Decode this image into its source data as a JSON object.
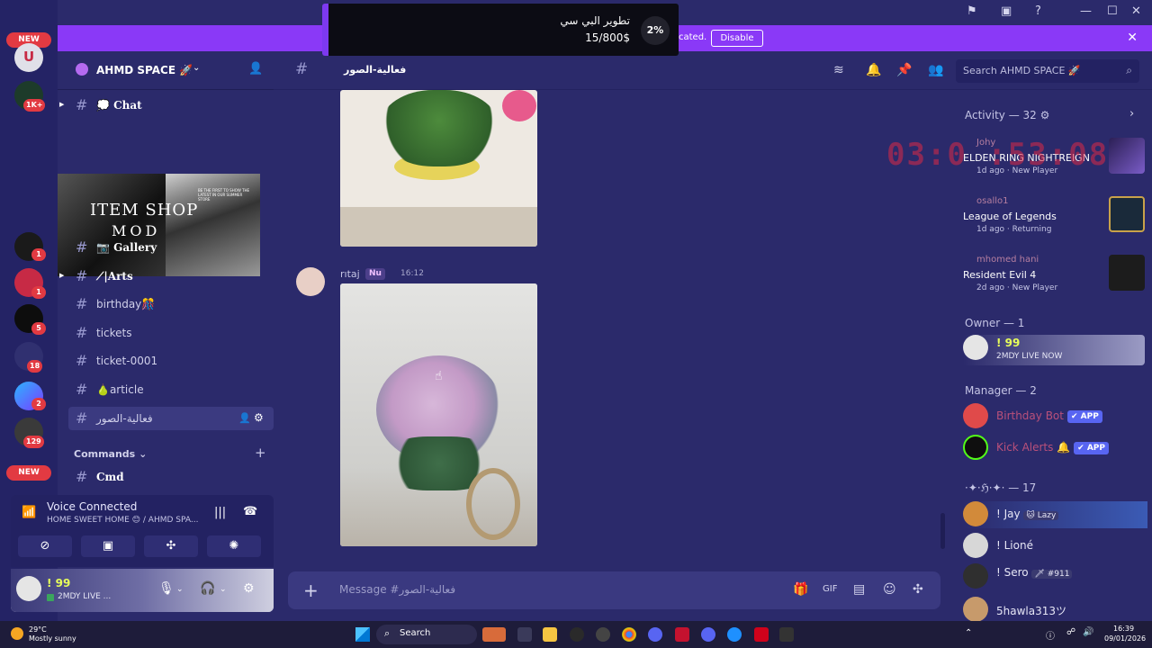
{
  "rail": {
    "new_label": "NEW",
    "badges": [
      "1K+",
      "1",
      "1",
      "5",
      "18",
      "2",
      "129"
    ]
  },
  "notice": {
    "text": "cated.",
    "button": "Disable"
  },
  "donation": {
    "title": "تطوير البي سي",
    "amount": "15/800$",
    "percent": "2%",
    "progress": 0.02
  },
  "server": {
    "name": "AHMD SPACE 🚀"
  },
  "channels": [
    {
      "label": "💭 Chat",
      "bold": true
    },
    {
      "label": "📷 Gallery",
      "bold": true
    },
    {
      "label": "⟋|Arts",
      "bold": true
    },
    {
      "label": "birthday🎊",
      "bold": false
    },
    {
      "label": "tickets",
      "bold": false
    },
    {
      "label": "ticket-0001",
      "bold": false
    },
    {
      "label": "🍐article",
      "bold": false
    },
    {
      "label": "فعالية-الصور",
      "bold": false,
      "active": true
    }
  ],
  "category": {
    "label": "Commands",
    "channel": "Cmd"
  },
  "itemshop": {
    "line1": "ITEM SHOP",
    "line2": "MOD",
    "small": "BE THE FIRST TO SHOW THE LATEST IN OUR SUMMER STORE"
  },
  "voice": {
    "title": "Voice Connected",
    "subtitle": "HOME SWEET HOME 😊 / AHMD SPA..."
  },
  "user": {
    "name": "! 99",
    "status": "2MDY LIVE ..."
  },
  "chat": {
    "channel": "فعالية-الصور",
    "search_placeholder": "Search AHMD SPACE 🚀",
    "author": "rıtaj",
    "author_tag": "Nu",
    "time": "16:12",
    "composer_placeholder": "Message #فعالية-الصور"
  },
  "members": {
    "activity_header": "Activity — 32",
    "timer": "03:0 :53:08",
    "activities": [
      {
        "user": "Johy",
        "game": "ELDEN RING NIGHTREIGN",
        "when": "1d ago",
        "status": "New Player"
      },
      {
        "user": "osallo1",
        "game": "League of Legends",
        "when": "1d ago",
        "status": "Returning"
      },
      {
        "user": "mhomed hani",
        "game": "Resident Evil 4",
        "when": "2d ago",
        "status": "New Player"
      }
    ],
    "owner_header": "Owner — 1",
    "owner": {
      "name": "! 99",
      "status": "2MDY LIVE NOW"
    },
    "manager_header": "Manager — 2",
    "managers": [
      {
        "name": "Birthday Bot",
        "badge": "✔ APP"
      },
      {
        "name": "Kick Alerts 🔔",
        "badge": "✔ APP"
      }
    ],
    "group_header": "·✦·ℌ·✦· — 17",
    "group": [
      {
        "name": "! Jay",
        "tag": "🐱 Lazy"
      },
      {
        "name": "! Lioné",
        "tag": ""
      },
      {
        "name": "! Sero",
        "tag": "🗡 #911"
      },
      {
        "name": "5hawla313ツ",
        "tag": ""
      }
    ]
  },
  "taskbar": {
    "temp": "29°C",
    "weather": "Mostly sunny",
    "search": "Search",
    "time": "16:39",
    "date": "09/01/2026"
  }
}
